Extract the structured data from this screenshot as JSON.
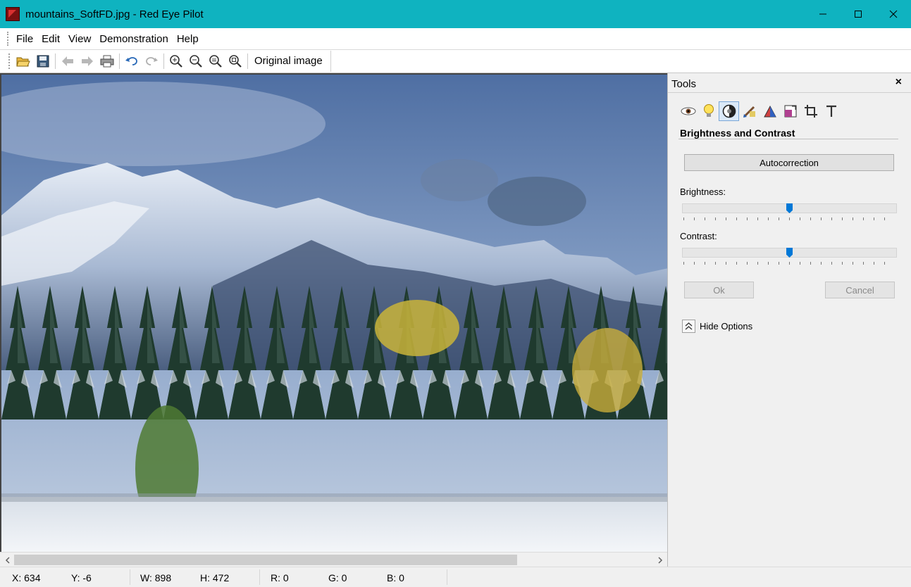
{
  "window": {
    "title": "mountains_SoftFD.jpg - Red Eye Pilot"
  },
  "menu": [
    "File",
    "Edit",
    "View",
    "Demonstration",
    "Help"
  ],
  "toolbar": {
    "original_image_label": "Original image"
  },
  "tools_panel": {
    "title": "Tools",
    "close_label": "×",
    "section_title": "Brightness and Contrast",
    "autocorrection_label": "Autocorrection",
    "brightness_label": "Brightness:",
    "contrast_label": "Contrast:",
    "brightness_value": 0.5,
    "contrast_value": 0.5,
    "ok_label": "Ok",
    "cancel_label": "Cancel",
    "hide_options_label": "Hide Options",
    "tool_icons": [
      "eye-icon",
      "bulb-icon",
      "brightness-contrast-icon",
      "brush-icon",
      "triangle-icon",
      "resize-icon",
      "crop-icon",
      "text-icon"
    ]
  },
  "status": {
    "x": "X: 634",
    "y": "Y: -6",
    "w": "W: 898",
    "h": "H: 472",
    "r": "R: 0",
    "g": "G: 0",
    "b": "B: 0"
  }
}
